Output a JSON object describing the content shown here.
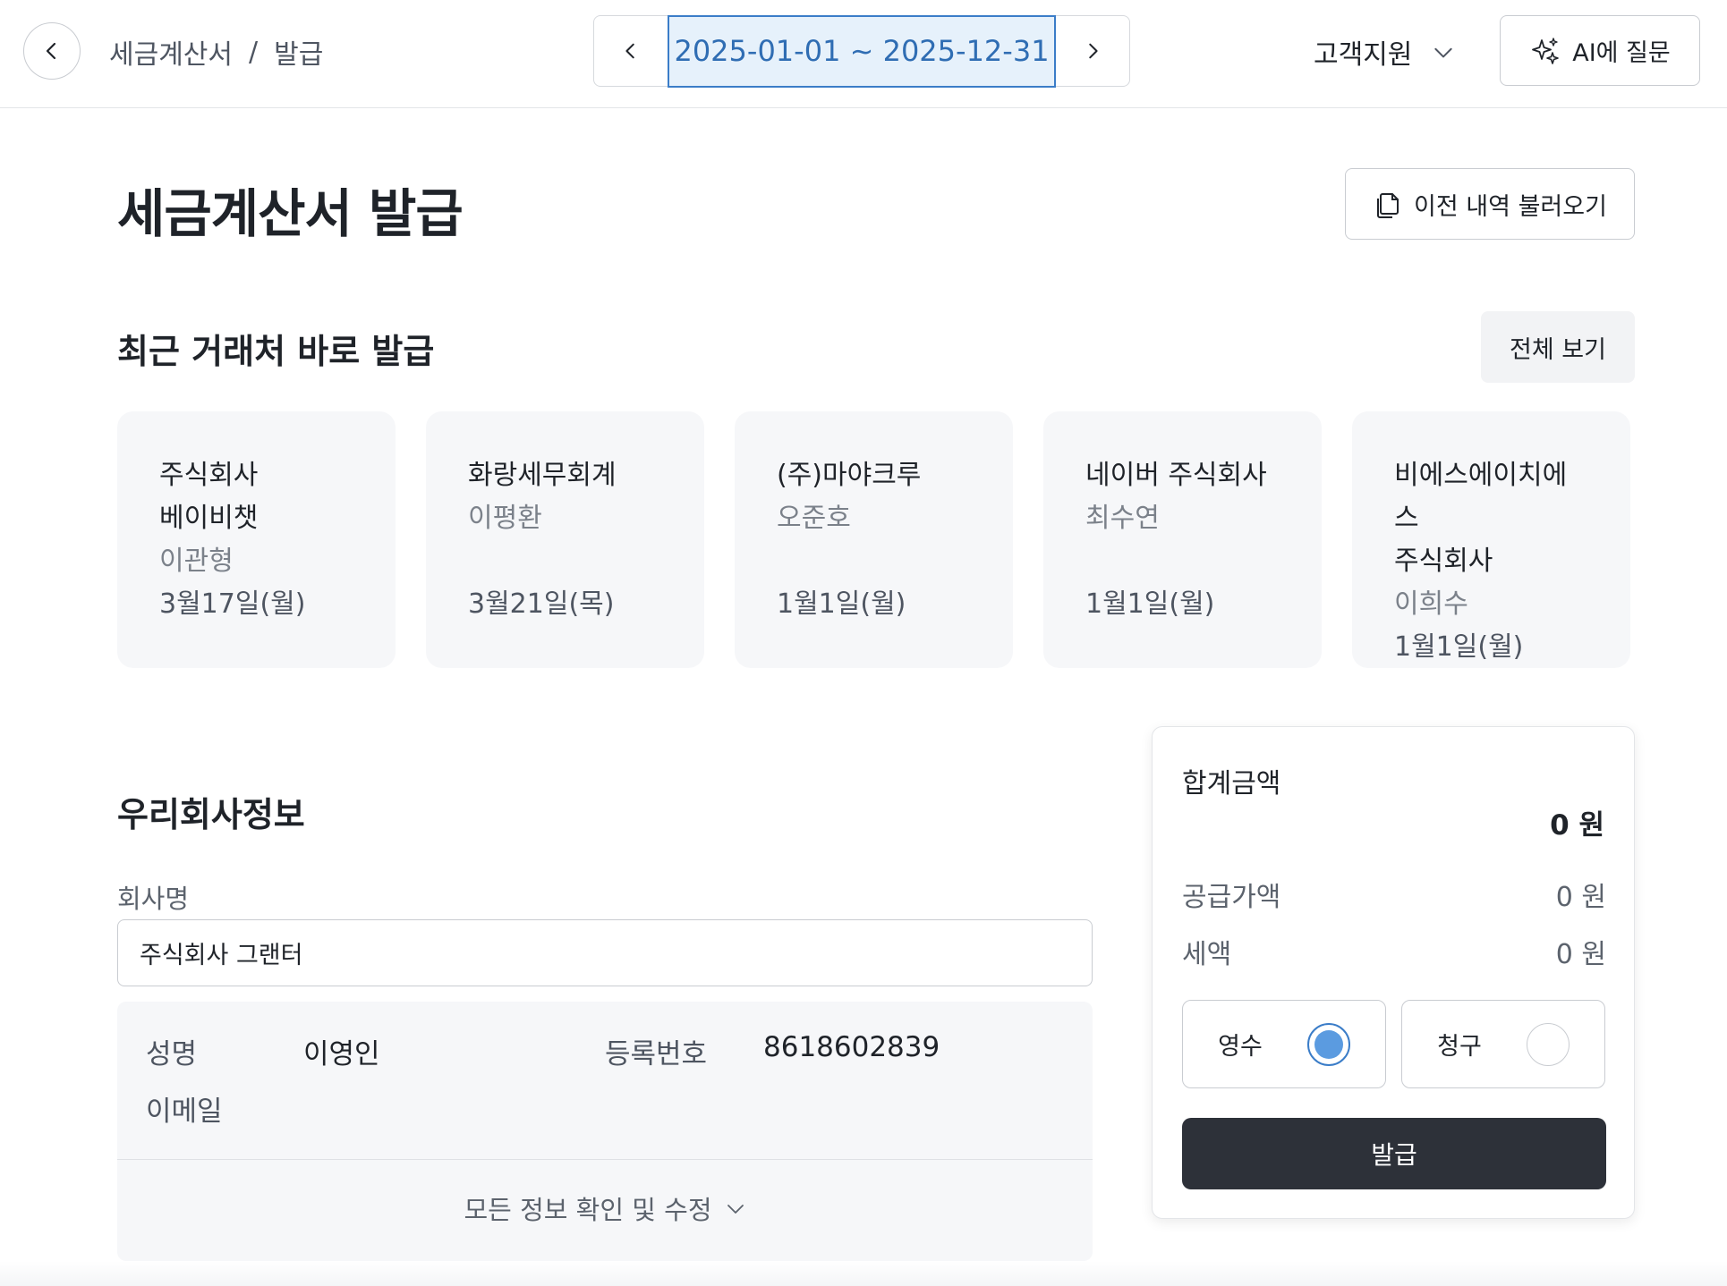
{
  "header": {
    "breadcrumb": [
      "세금계산서",
      "/",
      "발급"
    ],
    "date_range": "2025-01-01 ~ 2025-12-31",
    "support_label": "고객지원",
    "ai_label": "AI에 질문"
  },
  "page": {
    "title": "세금계산서 발급",
    "history_label": "이전 내역 불러오기"
  },
  "recent": {
    "title": "최근 거래처 바로 발급",
    "view_all_label": "전체 보기",
    "cards": [
      {
        "company": [
          "주식회사",
          "베이비챗"
        ],
        "person": "이관형",
        "date": "3월17일(월)"
      },
      {
        "company": [
          "화랑세무회계"
        ],
        "person": "이평환",
        "date": "3월21일(목)"
      },
      {
        "company": [
          "(주)마야크루"
        ],
        "person": "오준호",
        "date": "1월1일(월)"
      },
      {
        "company": [
          "네이버 주식회사"
        ],
        "person": "최수연",
        "date": "1월1일(월)"
      },
      {
        "company": [
          "비에스에이치에스",
          "주식회사"
        ],
        "person": "이희수",
        "date": "1월1일(월)"
      }
    ]
  },
  "company_info": {
    "title": "우리회사정보",
    "name_label": "회사명",
    "name_value": "주식회사 그랜터",
    "rep_label": "성명",
    "rep_value": "이영인",
    "reg_label": "등록번호",
    "reg_value": "8618602839",
    "email_label": "이메일",
    "expand_label": "모든 정보 확인 및 수정"
  },
  "summary": {
    "title": "합계금액",
    "total": "0 원",
    "supply_label": "공급가액",
    "supply_value": "0 원",
    "tax_label": "세액",
    "tax_value": "0 원",
    "receipt_label": "영수",
    "claim_label": "청구",
    "selected": "영수",
    "issue_label": "발급"
  },
  "colors": {
    "accent": "#3b7dc8",
    "dark_button": "#2d3139"
  }
}
